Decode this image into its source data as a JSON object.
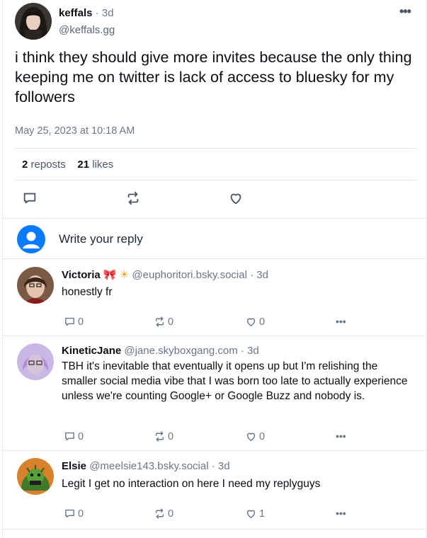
{
  "post": {
    "author_name": "keffals",
    "time_ago": "3d",
    "handle": "@keffals.gg",
    "text": "i think they should give more invites because the only thing keeping me on twitter is lack of access to bluesky for my followers",
    "timestamp": "May 25, 2023 at 10:18 AM",
    "reposts_count": "2",
    "reposts_label": "reposts",
    "likes_count": "21",
    "likes_label": "likes",
    "more_icon": "ellipsis-icon"
  },
  "composer": {
    "placeholder": "Write your reply"
  },
  "replies": [
    {
      "name": "Victoria",
      "emoji1": "🎀",
      "emoji2": "☀",
      "handle": "@euphoritori.bsky.social",
      "time_ago": "3d",
      "text": "honestly fr",
      "reply_count": "0",
      "repost_count": "0",
      "like_count": "0"
    },
    {
      "name": "KineticJane",
      "handle": "@jane.skyboxgang.com",
      "time_ago": "3d",
      "text": "TBH it's inevitable that eventually it opens up but I'm relishing the smaller social media vibe that I was born too late to actually experience unless we're counting Google+ or Google Buzz and nobody is.",
      "reply_count": "0",
      "repost_count": "0",
      "like_count": "0"
    },
    {
      "name": "Elsie",
      "handle": "@meelsie143.bsky.social",
      "time_ago": "3d",
      "text": "Legit I get no interaction on here I need my replyguys",
      "reply_count": "0",
      "repost_count": "0",
      "like_count": "1"
    }
  ],
  "colors": {
    "accent": "#0a7aff",
    "muted_text": "#6b7785",
    "divider": "#e3e7ec"
  }
}
